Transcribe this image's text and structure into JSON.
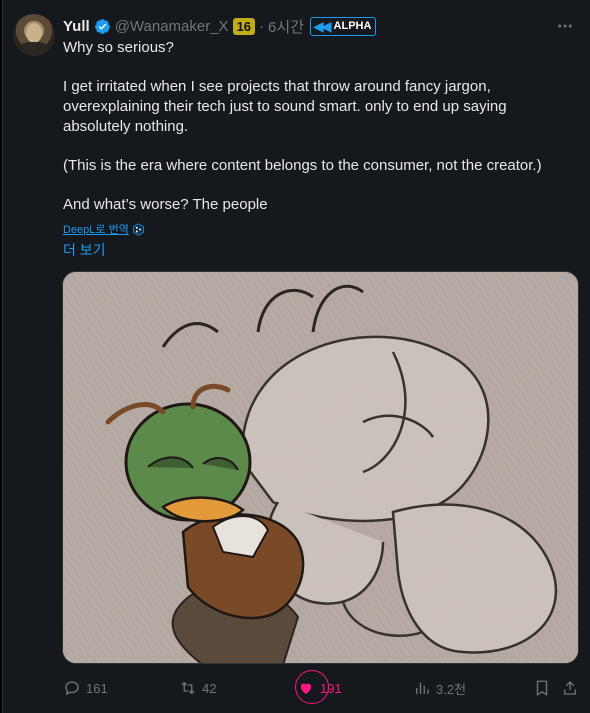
{
  "tweet": {
    "display_name": "Yull",
    "handle": "@Wanamaker_X",
    "level_badge": "16",
    "separator": "·",
    "time": "6시간",
    "alpha_label": "ALPHA",
    "lines": [
      "Why so serious?",
      "I get irritated when I see projects that throw around fancy jargon, overexplaining their tech just to sound smart. only to end up saying absolutely nothing.",
      "(This is the era where content belongs to the consumer, not the creator.)",
      "And what’s worse? The people"
    ],
    "translate_label": "DeepL로 번역",
    "show_more": "더 보기"
  },
  "actions": {
    "replies": "161",
    "reposts": "42",
    "likes": "191",
    "views": "3.2천"
  },
  "colors": {
    "accent": "#1d9bf0",
    "like": "#f91880",
    "background": "#15181c",
    "muted": "#71767b"
  },
  "icons": [
    "verified-icon",
    "more-icon",
    "deepl-icon",
    "reply-icon",
    "repost-icon",
    "like-icon",
    "views-icon",
    "bookmark-icon",
    "share-icon"
  ]
}
